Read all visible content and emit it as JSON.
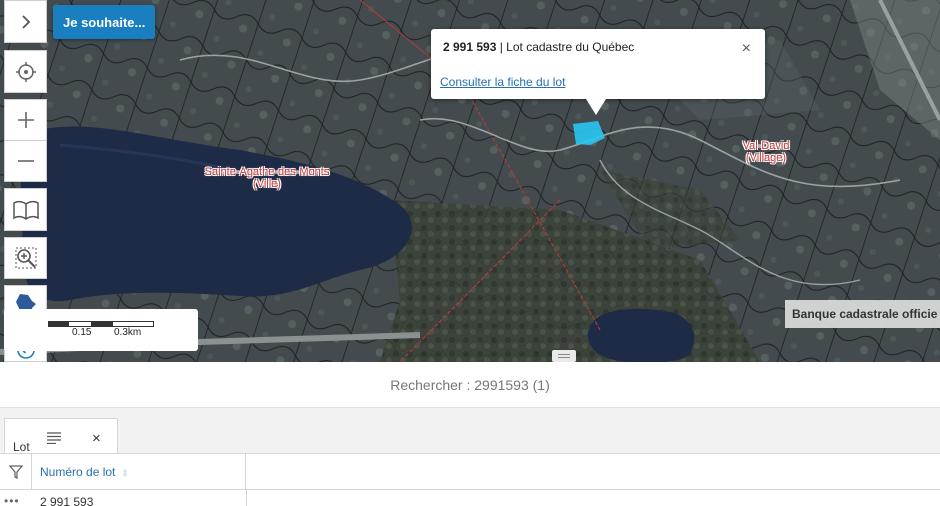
{
  "map": {
    "places": [
      {
        "name": "Sainte-Agathe-des-Monts",
        "type": "(Ville)"
      },
      {
        "name": "Val-David",
        "type": "(Village)"
      }
    ],
    "scale": {
      "ticks": [
        "0.15",
        "0.3km"
      ]
    },
    "attribution": "Banque cadastrale officie"
  },
  "toolbar": {
    "wish_button": "Je souhaite..."
  },
  "controls": {
    "expand_icon": "chevron-right-icon",
    "locate_icon": "crosshair-icon",
    "zoom_in_icon": "plus-icon",
    "zoom_out_icon": "minus-icon",
    "book_icon": "book-icon",
    "zoom_box_icon": "zoom-box-icon",
    "quebec_icon": "quebec-map-icon",
    "back_icon": "arrow-left-icon"
  },
  "popup": {
    "lot_number": "2 991 593",
    "title_rest": " | Lot cadastre du Québec",
    "close": "×",
    "link": "Consulter la fiche du lot"
  },
  "search": {
    "text": "Rechercher : 2991593 (1)"
  },
  "results": {
    "tab_label": "Lot",
    "tab_close": "×",
    "column_header": "Numéro de lot",
    "sort_glyph": "⇳",
    "rows": [
      {
        "dots": "•••",
        "value": "2 991 593"
      }
    ]
  },
  "colors": {
    "accent": "#1a7fc1",
    "link": "#2770b5",
    "lot_highlight": "#29c7f2",
    "place_label": "#d23a3a"
  }
}
